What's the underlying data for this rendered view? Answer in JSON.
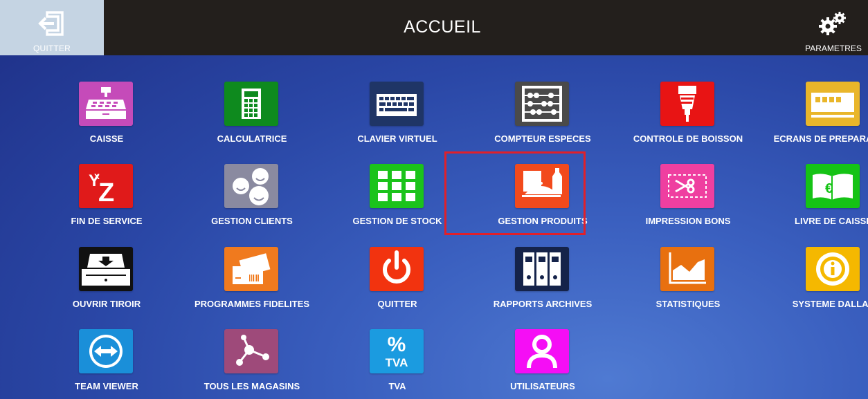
{
  "header": {
    "title": "ACCUEIL",
    "quit_label": "QUITTER",
    "settings_label": "PARAMETRES"
  },
  "tiles": [
    {
      "label": "CAISSE",
      "icon": "cash-register-icon",
      "color": "#c54bb9"
    },
    {
      "label": "CALCULATRICE",
      "icon": "calculator-icon",
      "color": "#0e8a1e"
    },
    {
      "label": "CLAVIER VIRTUEL",
      "icon": "keyboard-icon",
      "color": "#1f3566"
    },
    {
      "label": "COMPTEUR ESPECES",
      "icon": "abacus-icon",
      "color": "#4a4a4a"
    },
    {
      "label": "CONTROLE DE BOISSON",
      "icon": "drink-dispenser-icon",
      "color": "#e81414"
    },
    {
      "label": "ECRANS DE PREPARATION",
      "icon": "kitchen-screen-icon",
      "color": "#e9b62a"
    },
    {
      "label": "FIN DE SERVICE",
      "icon": "xyz-report-icon",
      "color": "#e01a1a"
    },
    {
      "label": "GESTION CLIENTS",
      "icon": "customers-icon",
      "color": "#8a8aa0"
    },
    {
      "label": "GESTION DE STOCK",
      "icon": "stock-grid-icon",
      "color": "#1bc31b"
    },
    {
      "label": "GESTION PRODUITS",
      "icon": "products-icon",
      "color": "#f24a1c"
    },
    {
      "label": "IMPRESSION BONS",
      "icon": "voucher-print-icon",
      "color": "#ef3fa0"
    },
    {
      "label": "LIVRE DE CAISSE",
      "icon": "cash-book-icon",
      "color": "#15c315"
    },
    {
      "label": "OUVRIR TIROIR",
      "icon": "cash-drawer-icon",
      "color": "#111111"
    },
    {
      "label": "PROGRAMMES FIDELITES",
      "icon": "loyalty-cards-icon",
      "color": "#f07a1e"
    },
    {
      "label": "QUITTER",
      "icon": "power-icon",
      "color": "#f2330f"
    },
    {
      "label": "RAPPORTS ARCHIVES",
      "icon": "archive-binders-icon",
      "color": "#15234a"
    },
    {
      "label": "STATISTIQUES",
      "icon": "area-chart-icon",
      "color": "#e8700f"
    },
    {
      "label": "SYSTEME DALLAS",
      "icon": "dallas-key-icon",
      "color": "#f5b800"
    },
    {
      "label": "TEAM VIEWER",
      "icon": "teamviewer-icon",
      "color": "#1a8fd9"
    },
    {
      "label": "TOUS LES MAGASINS",
      "icon": "network-icon",
      "color": "#9e4a7a"
    },
    {
      "label": "TVA",
      "icon": "vat-percent-icon",
      "color": "#1b9be0"
    },
    {
      "label": "UTILISATEURS",
      "icon": "user-icon",
      "color": "#f50ef5"
    }
  ],
  "highlighted_tile": "GESTION PRODUITS",
  "highlight_color": "#e0202a"
}
